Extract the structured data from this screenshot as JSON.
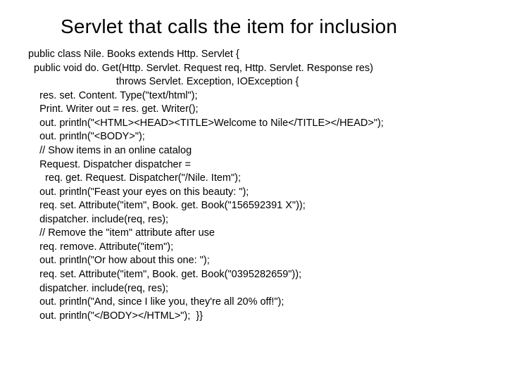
{
  "title": "Servlet that calls the item for inclusion",
  "code_lines": [
    "public class Nile. Books extends Http. Servlet {",
    "  public void do. Get(Http. Servlet. Request req, Http. Servlet. Response res)",
    "                               throws Servlet. Exception, IOException {",
    "    res. set. Content. Type(\"text/html\");",
    "    Print. Writer out = res. get. Writer();",
    "    out. println(\"<HTML><HEAD><TITLE>Welcome to Nile</TITLE></HEAD>\");",
    "    out. println(\"<BODY>\");",
    "    // Show items in an online catalog",
    "    Request. Dispatcher dispatcher =",
    "      req. get. Request. Dispatcher(\"/Nile. Item\");",
    "    out. println(\"Feast your eyes on this beauty: \");",
    "    req. set. Attribute(\"item\", Book. get. Book(\"156592391 X\"));",
    "    dispatcher. include(req, res);",
    "    // Remove the \"item\" attribute after use",
    "    req. remove. Attribute(\"item\");",
    "    out. println(\"Or how about this one: \");",
    "    req. set. Attribute(\"item\", Book. get. Book(\"0395282659\"));",
    "    dispatcher. include(req, res);",
    "    out. println(\"And, since I like you, they're all 20% off!\");",
    "    out. println(\"</BODY></HTML>\");  }}"
  ]
}
